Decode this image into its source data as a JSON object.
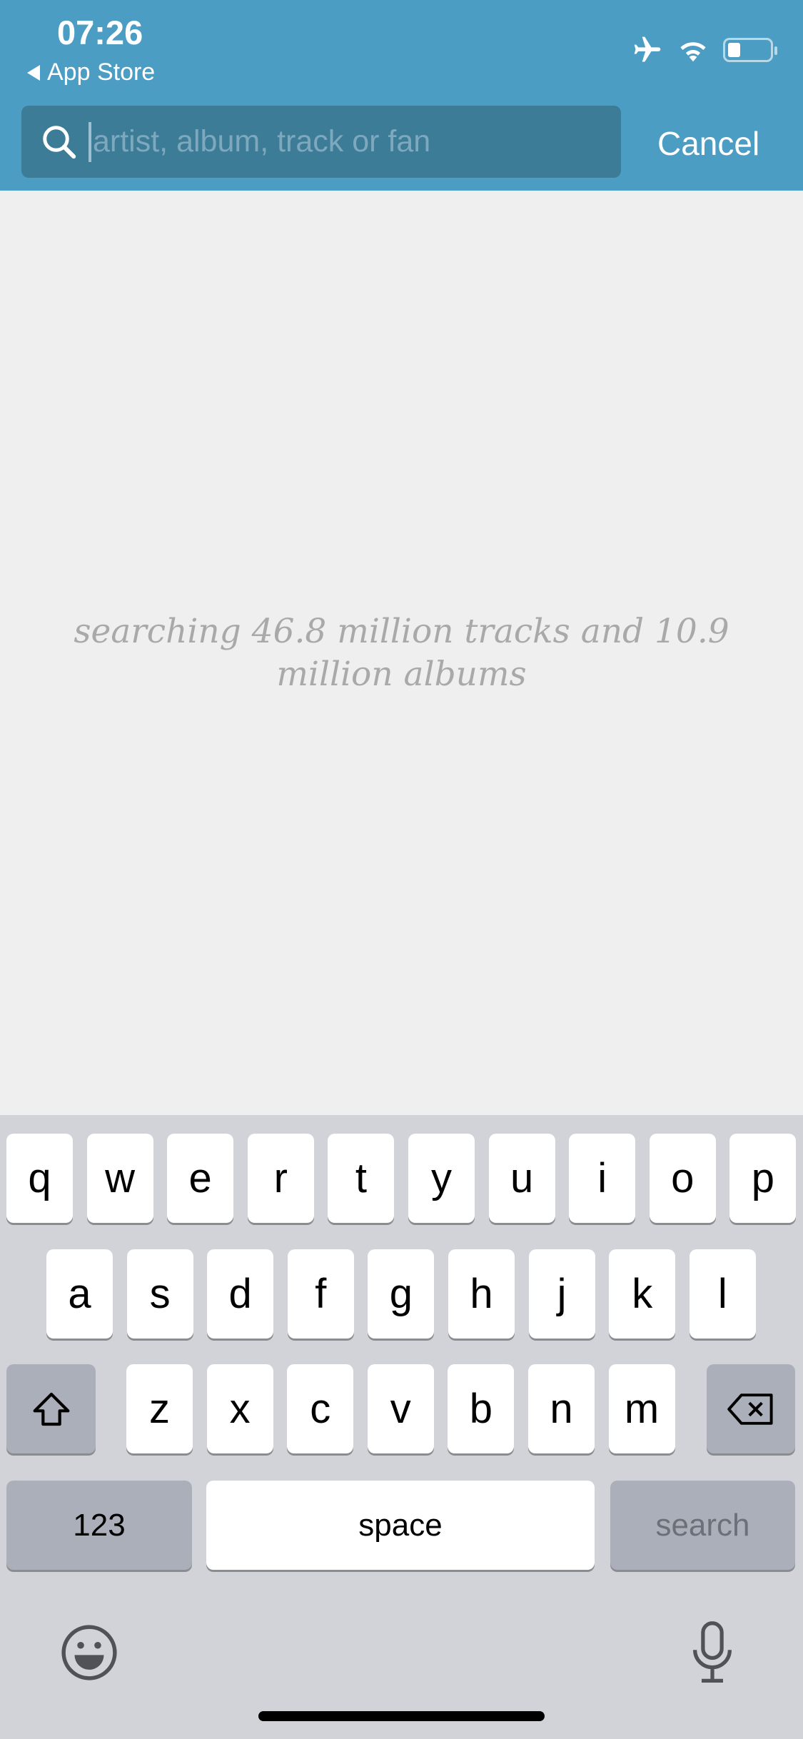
{
  "status_bar": {
    "time": "07:26",
    "back_label": "App Store",
    "icons": [
      "airplane-icon",
      "wifi-icon",
      "battery-icon"
    ],
    "battery_level": 0.25
  },
  "search": {
    "placeholder": "artist, album, track or fan",
    "value": "",
    "cancel_label": "Cancel"
  },
  "main": {
    "message": "searching 46.8 million tracks and 10.9 million albums"
  },
  "keyboard": {
    "row1": [
      "q",
      "w",
      "e",
      "r",
      "t",
      "y",
      "u",
      "i",
      "o",
      "p"
    ],
    "row2": [
      "a",
      "s",
      "d",
      "f",
      "g",
      "h",
      "j",
      "k",
      "l"
    ],
    "row3": [
      "z",
      "x",
      "c",
      "v",
      "b",
      "n",
      "m"
    ],
    "numbers_label": "123",
    "space_label": "space",
    "search_label": "search"
  },
  "colors": {
    "header": "#4c9dc3",
    "search_field": "#3d7c97",
    "keyboard": "#d1d3d9"
  }
}
